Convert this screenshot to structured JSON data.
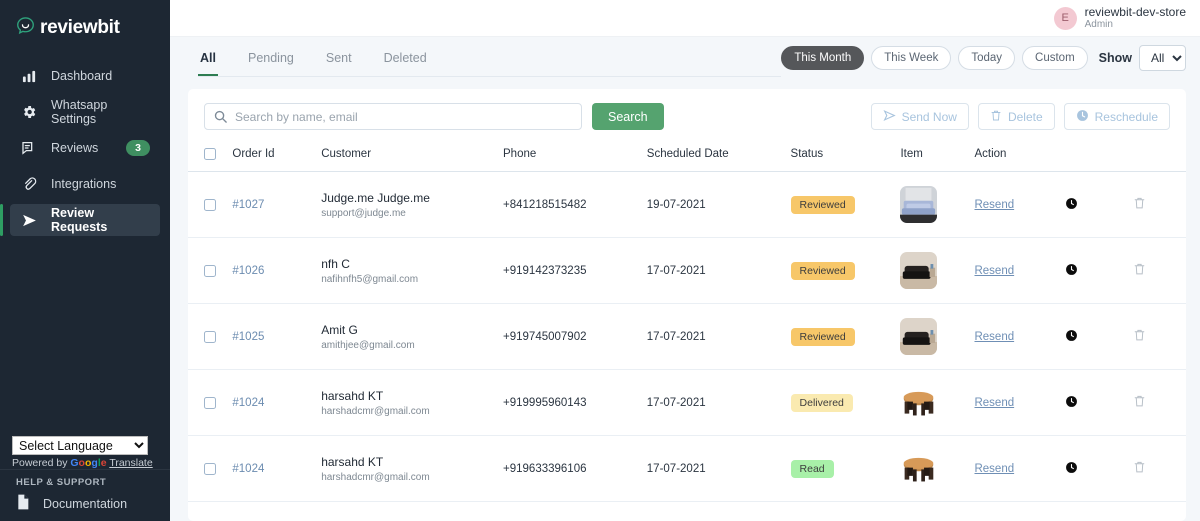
{
  "sidebar": {
    "logo_text": "reviewbit",
    "items": [
      {
        "label": "Dashboard",
        "icon": "bar-chart-icon",
        "badge": ""
      },
      {
        "label": "Whatsapp Settings",
        "icon": "gear-icon",
        "badge": ""
      },
      {
        "label": "Reviews",
        "icon": "reviews-icon",
        "badge": "3"
      },
      {
        "label": "Integrations",
        "icon": "link-icon",
        "badge": ""
      },
      {
        "label": "Review Requests",
        "icon": "send-icon",
        "badge": ""
      }
    ],
    "translate": {
      "selected": "Select Language",
      "powered_by": "Powered by",
      "brand": "Google",
      "link": "Translate"
    },
    "support": {
      "title": "HELP & SUPPORT",
      "documentation": "Documentation"
    }
  },
  "topbar": {
    "avatar_letter": "E",
    "store_name": "reviewbit-dev-store",
    "role": "Admin"
  },
  "tabs": [
    {
      "label": "All",
      "active": true
    },
    {
      "label": "Pending",
      "active": false
    },
    {
      "label": "Sent",
      "active": false
    },
    {
      "label": "Deleted",
      "active": false
    }
  ],
  "ranges": [
    {
      "label": "This Month",
      "active": true
    },
    {
      "label": "This Week",
      "active": false
    },
    {
      "label": "Today",
      "active": false
    },
    {
      "label": "Custom",
      "active": false
    }
  ],
  "show": {
    "label": "Show",
    "value": "All",
    "options": [
      "All"
    ]
  },
  "search": {
    "placeholder": "Search by name, email",
    "value": "",
    "button": "Search"
  },
  "bulk_actions": [
    {
      "label": "Send Now",
      "icon": "send-icon"
    },
    {
      "label": "Delete",
      "icon": "trash-icon"
    },
    {
      "label": "Reschedule",
      "icon": "clock-icon"
    }
  ],
  "table": {
    "columns": [
      "Order Id",
      "Customer",
      "Phone",
      "Scheduled Date",
      "Status",
      "Item",
      "Action"
    ],
    "rows": [
      {
        "order_id": "#1027",
        "customer": "Judge.me Judge.me",
        "email": "support@judge.me",
        "phone": "+841218515482",
        "scheduled_date": "19-07-2021",
        "status": "Reviewed",
        "status_color": "#f7c769",
        "item": "blue-sofa",
        "action": "Resend"
      },
      {
        "order_id": "#1026",
        "customer": "nfh C",
        "email": "nafihnfh5@gmail.com",
        "phone": "+919142373235",
        "scheduled_date": "17-07-2021",
        "status": "Reviewed",
        "status_color": "#f7c769",
        "item": "black-sofa",
        "action": "Resend"
      },
      {
        "order_id": "#1025",
        "customer": "Amit G",
        "email": "amithjee@gmail.com",
        "phone": "+919745007902",
        "scheduled_date": "17-07-2021",
        "status": "Reviewed",
        "status_color": "#f7c769",
        "item": "black-sofa",
        "action": "Resend"
      },
      {
        "order_id": "#1024",
        "customer": "harsahd KT",
        "email": "harshadcmr@gmail.com",
        "phone": "+919995960143",
        "scheduled_date": "17-07-2021",
        "status": "Delivered",
        "status_color": "#faeab0",
        "item": "dining-table",
        "action": "Resend"
      },
      {
        "order_id": "#1024",
        "customer": "harsahd KT",
        "email": "harshadcmr@gmail.com",
        "phone": "+919633396106",
        "scheduled_date": "17-07-2021",
        "status": "Read",
        "status_color": "#a8f0a8",
        "item": "dining-table",
        "action": "Resend"
      }
    ]
  },
  "colors": {
    "sidebar_bg": "#1d2733",
    "accent_green": "#2e9e63",
    "search_button": "#55a36f",
    "link_blue": "#6c8cb0"
  }
}
